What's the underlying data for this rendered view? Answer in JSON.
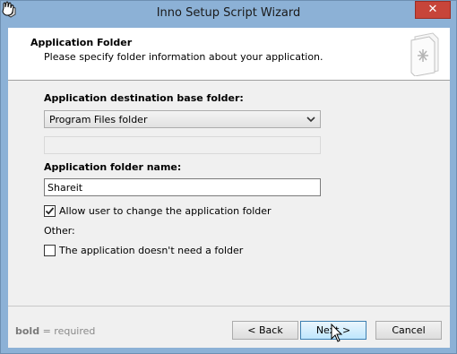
{
  "window": {
    "title": "Inno Setup Script Wizard",
    "close_glyph": "✕"
  },
  "header": {
    "title": "Application Folder",
    "subtitle": "Please specify folder information about your application."
  },
  "form": {
    "base_folder_label": "Application destination base folder:",
    "base_folder_select": {
      "selected": "Program Files folder",
      "icon": "chevron-down-icon"
    },
    "custom_folder_value": "",
    "folder_name_label": "Application folder name:",
    "folder_name_value": "Shareit",
    "allow_change": {
      "label": "Allow user to change the application folder",
      "checked": true
    },
    "other_label": "Other:",
    "no_folder": {
      "label": "The application doesn't need a folder",
      "checked": false
    }
  },
  "footer": {
    "note_bold": "bold",
    "note_rest": " = required",
    "back_label": "< Back",
    "next_label": "Next >",
    "cancel_label": "Cancel"
  }
}
